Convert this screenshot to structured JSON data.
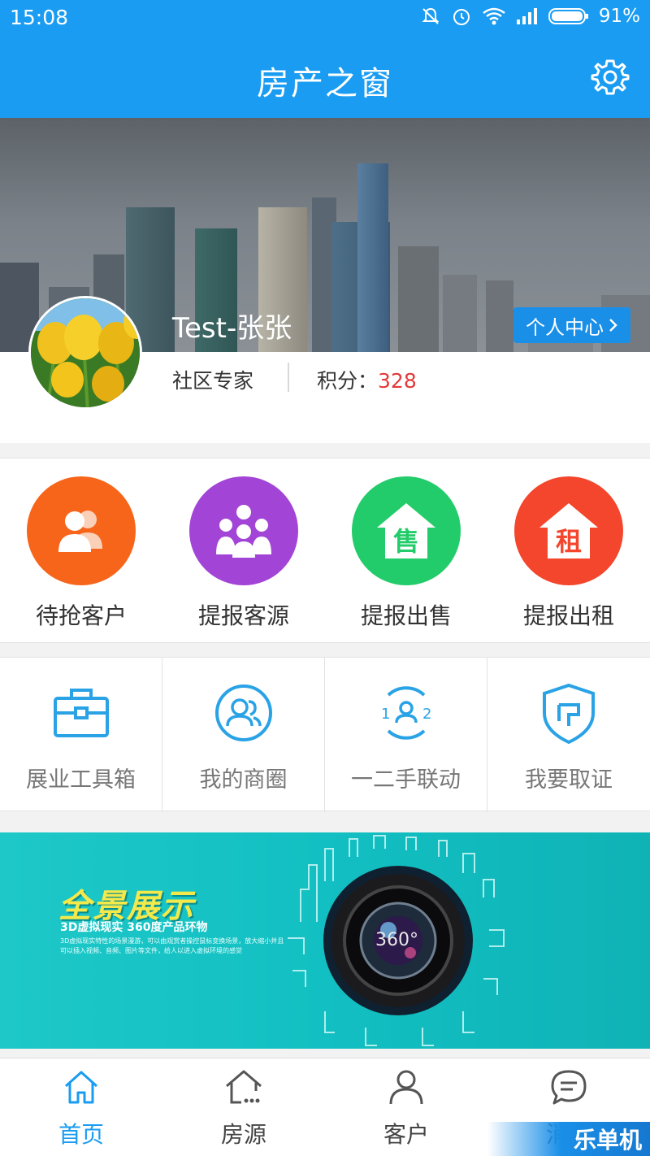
{
  "status_bar": {
    "time": "15:08",
    "battery": "91%",
    "icons": [
      "mute-icon",
      "alarm-icon",
      "wifi-icon",
      "signal-icon",
      "battery-icon"
    ]
  },
  "header": {
    "title": "房产之窗",
    "settings_icon": "gear-icon"
  },
  "profile": {
    "username": "Test-张张",
    "center_button": "个人中心",
    "role": "社区专家",
    "points_label": "积分：",
    "points_value": "328"
  },
  "quick_actions": [
    {
      "label": "待抢客户",
      "icon": "customers-icon",
      "color": "#f7651b"
    },
    {
      "label": "提报客源",
      "icon": "group-icon",
      "color": "#a244d6"
    },
    {
      "label": "提报出售",
      "icon": "house-sale-icon",
      "glyph": "售",
      "color": "#23cc6a"
    },
    {
      "label": "提报出租",
      "icon": "house-rent-icon",
      "glyph": "租",
      "color": "#f3462c"
    }
  ],
  "tools": [
    {
      "label": "展业工具箱",
      "icon": "toolbox-icon"
    },
    {
      "label": "我的商圈",
      "icon": "circle-users-icon"
    },
    {
      "label": "一二手联动",
      "icon": "linkage-icon"
    },
    {
      "label": "我要取证",
      "icon": "shield-icon"
    }
  ],
  "promo": {
    "title": "全景展示",
    "subtitle": "3D虚拟现实 360度产品环物",
    "description": "3D虚拟现实特性的场景漫游，可以由观赏者操控鼠标变换场景，放大缩小并且可以插入视频、音频、图片等文件，给人以进入虚拟环境的感觉",
    "lens_text": "360°"
  },
  "bottom_nav": [
    {
      "label": "首页",
      "icon": "home-icon",
      "active": true
    },
    {
      "label": "房源",
      "icon": "house-listing-icon",
      "active": false
    },
    {
      "label": "客户",
      "icon": "person-icon",
      "active": false
    },
    {
      "label": "消息",
      "icon": "message-icon",
      "active": false
    }
  ],
  "watermark": "乐单机",
  "colors": {
    "primary": "#1a9cf2",
    "points": "#e23a3a"
  }
}
